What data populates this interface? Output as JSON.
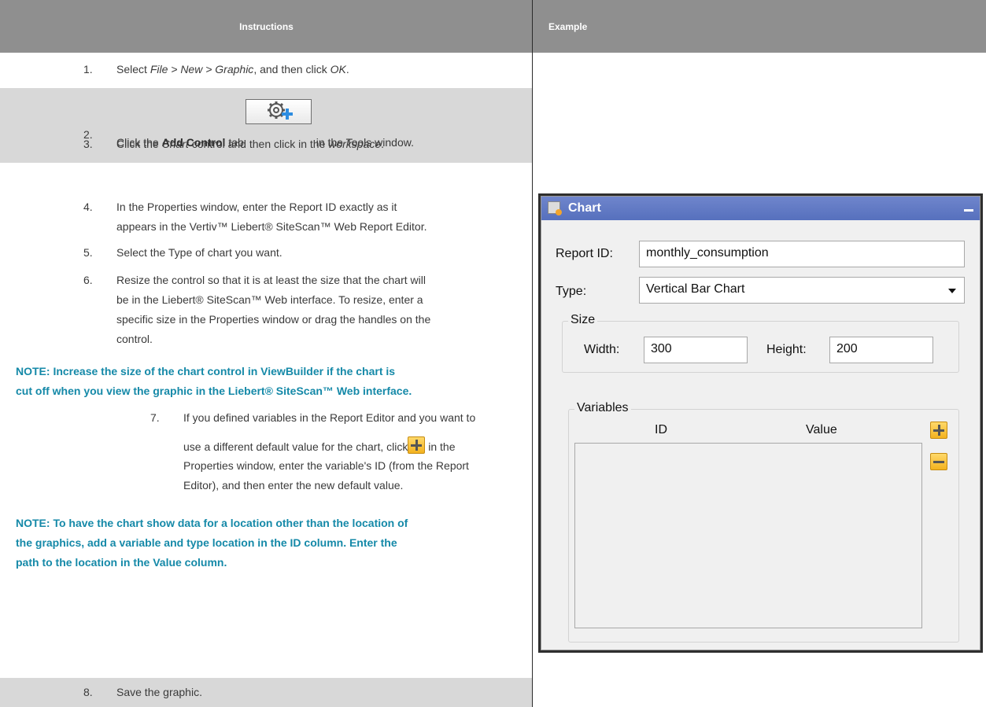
{
  "header": {
    "instructions": "Instructions",
    "example": "Example"
  },
  "steps": {
    "s1": {
      "num": "1.",
      "a": "Select ",
      "b": "File > New > Graphic",
      "c": ", and then click ",
      "d": "OK",
      "e": "."
    },
    "s2": {
      "num": "2.",
      "a": "Click the ",
      "b": "Add Control",
      "c": " tab",
      "d": " in the Tools window."
    },
    "s3": {
      "num": "3.",
      "a": "Click the ",
      "b": "Chart",
      "c": " control and then click in the ",
      "d": "workspace",
      "e": "."
    },
    "s4": {
      "num": "4.",
      "line1": "In the Properties window, enter the Report ID exactly as it",
      "line2": "appears in the Vertiv™ Liebert® SiteScan™ Web Report Editor."
    },
    "s5": {
      "num": "5.",
      "text": "Select the Type of chart you want."
    },
    "s6": {
      "num": "6.",
      "line1": "Resize the control so that it is at least the size that the chart will",
      "line2": "be in the Liebert® SiteScan™ Web interface. To resize, enter a",
      "line3": "specific size in the Properties window or drag the handles on the",
      "line4": "control."
    },
    "s7": {
      "num": "7.",
      "line1": "If you defined variables in the Report Editor and you want to",
      "line2a": "use a different default value for the chart, click",
      "line2b": " in the",
      "line3": "Properties window, enter the variable's ID (from the Report",
      "line4": "Editor), and then enter the new default value."
    },
    "s8": {
      "num": "8.",
      "text": "Save the graphic."
    }
  },
  "notes": {
    "n1_line1": "NOTE: Increase the size of the chart control in ViewBuilder if the chart is",
    "n1_line2": "cut off when you view the graphic in the Liebert® SiteScan™ Web interface.",
    "n2_line1": "NOTE: To have the chart show data for a location other than the location of",
    "n2_line2": "the graphics, add a variable and type location in the ID column. Enter the",
    "n2_line3": "path to the location in the Value column."
  },
  "panel": {
    "title": "Chart",
    "report_id_label": "Report ID:",
    "report_id_value": "monthly_consumption",
    "type_label": "Type:",
    "type_value": "Vertical Bar Chart",
    "size_group": "Size",
    "width_label": "Width:",
    "width_value": "300",
    "height_label": "Height:",
    "height_value": "200",
    "variables_group": "Variables",
    "col_id": "ID",
    "col_value": "Value"
  },
  "colors": {
    "header_bg": "#8f8f8f",
    "shaded_row": "#d8d8d8",
    "note_text": "#1589a8",
    "panel_title": "#5d76c2"
  }
}
